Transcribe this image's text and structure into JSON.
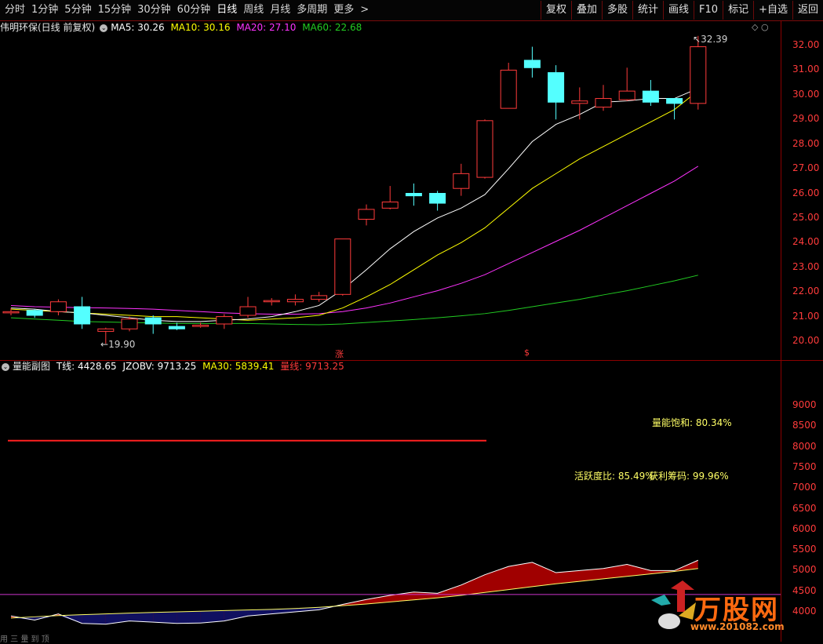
{
  "toolbar": {
    "periods": [
      "分时",
      "1分钟",
      "5分钟",
      "15分钟",
      "30分钟",
      "60分钟",
      "日线",
      "周线",
      "月线",
      "多周期",
      "更多"
    ],
    "more_arrow": ">",
    "buttons": [
      "复权",
      "叠加",
      "多股",
      "统计",
      "画线",
      "F10",
      "标记",
      "+自选",
      "返回"
    ]
  },
  "main_info": {
    "stock_name": "伟明环保(日线 前复权)",
    "ma5": "MA5: 30.26",
    "ma10": "MA10: 30.16",
    "ma20": "MA20: 27.10",
    "ma60": "MA60: 22.68"
  },
  "sub_info": {
    "title": "量能副图",
    "t_line": "T线: 4428.65",
    "jzobv": "JZOBV: 9713.25",
    "ma30": "MA30: 5839.41",
    "vol_line": "量线: 9713.25"
  },
  "price_axis": [
    "32.00",
    "31.00",
    "30.00",
    "29.00",
    "28.00",
    "27.00",
    "26.00",
    "25.00",
    "24.00",
    "23.00",
    "22.00",
    "21.00",
    "20.00"
  ],
  "sub_axis": [
    "9000",
    "8500",
    "8000",
    "7500",
    "7000",
    "6500",
    "6000",
    "5500",
    "5000",
    "4500",
    "4000"
  ],
  "annotations": {
    "high": "32.39",
    "low": "19.90",
    "mark_up": "涨",
    "mark_s": "$",
    "saturation": "量能饱和: 80.34%",
    "activity": "活跃度比: 85.49%",
    "profit": "获利筹码: 99.96%"
  },
  "watermark": {
    "brand": "万股网",
    "url": "www.201082.com"
  },
  "footer_text": "用 三 量 到 顶",
  "colors": {
    "up": "#ff3b3b",
    "down": "#54ffff",
    "ma5": "#ffffff",
    "ma10": "#ffff00",
    "ma20": "#ff33ff",
    "ma60": "#22cc22",
    "area": "#a00000",
    "axis": "#ff3b3b"
  },
  "candles": [
    {
      "o": 21.15,
      "c": 21.2,
      "h": 21.35,
      "l": 21.05
    },
    {
      "o": 21.25,
      "c": 21.05,
      "h": 21.3,
      "l": 20.95
    },
    {
      "o": 21.2,
      "c": 21.6,
      "h": 21.7,
      "l": 21.05
    },
    {
      "o": 21.4,
      "c": 20.7,
      "h": 21.8,
      "l": 20.5
    },
    {
      "o": 20.4,
      "c": 20.5,
      "h": 20.55,
      "l": 19.9
    },
    {
      "o": 20.5,
      "c": 20.9,
      "h": 21.0,
      "l": 20.4
    },
    {
      "o": 20.95,
      "c": 20.7,
      "h": 21.05,
      "l": 20.3
    },
    {
      "o": 20.6,
      "c": 20.5,
      "h": 20.75,
      "l": 20.45
    },
    {
      "o": 20.6,
      "c": 20.65,
      "h": 20.75,
      "l": 20.55
    },
    {
      "o": 20.7,
      "c": 21.0,
      "h": 21.1,
      "l": 20.5
    },
    {
      "o": 21.05,
      "c": 21.4,
      "h": 21.8,
      "l": 20.95
    },
    {
      "o": 21.6,
      "c": 21.65,
      "h": 21.75,
      "l": 21.45
    },
    {
      "o": 21.6,
      "c": 21.7,
      "h": 21.9,
      "l": 21.45
    },
    {
      "o": 21.7,
      "c": 21.85,
      "h": 22.0,
      "l": 21.6
    },
    {
      "o": 21.9,
      "c": 24.15,
      "h": 24.15,
      "l": 21.85
    },
    {
      "o": 24.95,
      "c": 25.35,
      "h": 25.55,
      "l": 24.7
    },
    {
      "o": 25.4,
      "c": 25.65,
      "h": 26.3,
      "l": 25.35
    },
    {
      "o": 26.0,
      "c": 25.9,
      "h": 26.4,
      "l": 25.5
    },
    {
      "o": 26.0,
      "c": 25.6,
      "h": 26.1,
      "l": 25.3
    },
    {
      "o": 26.2,
      "c": 26.8,
      "h": 27.2,
      "l": 25.9
    },
    {
      "o": 26.65,
      "c": 28.95,
      "h": 29.0,
      "l": 26.6
    },
    {
      "o": 29.45,
      "c": 31.0,
      "h": 31.3,
      "l": 29.45
    },
    {
      "o": 31.4,
      "c": 31.1,
      "h": 31.95,
      "l": 30.7
    },
    {
      "o": 30.9,
      "c": 29.7,
      "h": 31.2,
      "l": 29.0
    },
    {
      "o": 29.65,
      "c": 29.75,
      "h": 30.3,
      "l": 29.0
    },
    {
      "o": 29.5,
      "c": 29.85,
      "h": 30.4,
      "l": 29.35
    },
    {
      "o": 29.8,
      "c": 30.15,
      "h": 31.1,
      "l": 29.75
    },
    {
      "o": 30.15,
      "c": 29.7,
      "h": 30.6,
      "l": 29.55
    },
    {
      "o": 29.85,
      "c": 29.65,
      "h": 29.85,
      "l": 29.0
    },
    {
      "o": 29.65,
      "c": 31.95,
      "h": 32.39,
      "l": 29.4
    }
  ],
  "ma5_line": [
    21.35,
    21.3,
    21.2,
    21.15,
    21.05,
    20.95,
    20.85,
    20.8,
    20.8,
    20.85,
    20.9,
    21.0,
    21.2,
    21.45,
    22.1,
    22.9,
    23.75,
    24.45,
    25.0,
    25.4,
    25.95,
    27.0,
    28.1,
    28.8,
    29.2,
    29.7,
    29.75,
    29.85,
    29.85,
    30.26
  ],
  "ma10_line": [
    21.3,
    21.25,
    21.2,
    21.15,
    21.1,
    21.05,
    21.0,
    21.0,
    20.95,
    20.9,
    20.85,
    20.9,
    20.95,
    21.05,
    21.35,
    21.8,
    22.3,
    22.9,
    23.5,
    24.0,
    24.6,
    25.4,
    26.2,
    26.8,
    27.4,
    27.9,
    28.4,
    28.9,
    29.4,
    30.16
  ],
  "ma20_line": [
    21.45,
    21.4,
    21.38,
    21.36,
    21.35,
    21.33,
    21.3,
    21.25,
    21.2,
    21.15,
    21.12,
    21.1,
    21.1,
    21.12,
    21.2,
    21.35,
    21.55,
    21.8,
    22.05,
    22.35,
    22.7,
    23.15,
    23.6,
    24.05,
    24.5,
    25.0,
    25.5,
    26.0,
    26.5,
    27.1
  ],
  "ma60_line": [
    20.95,
    20.9,
    20.85,
    20.8,
    20.78,
    20.76,
    20.74,
    20.72,
    20.72,
    20.72,
    20.72,
    20.7,
    20.68,
    20.67,
    20.7,
    20.76,
    20.82,
    20.88,
    20.95,
    21.03,
    21.12,
    21.25,
    21.4,
    21.55,
    21.7,
    21.88,
    22.05,
    22.25,
    22.45,
    22.68
  ],
  "vol_line": [
    3900,
    3800,
    3950,
    3720,
    3700,
    3780,
    3750,
    3720,
    3730,
    3780,
    3900,
    3950,
    4000,
    4050,
    4180,
    4300,
    4400,
    4480,
    4450,
    4650,
    4900,
    5100,
    5200,
    4950,
    5000,
    5050,
    5150,
    5000,
    5000,
    5250
  ],
  "t_line": [
    3850,
    3880,
    3910,
    3930,
    3950,
    3970,
    3985,
    4000,
    4015,
    4030,
    4045,
    4060,
    4080,
    4110,
    4150,
    4190,
    4240,
    4290,
    4340,
    4400,
    4470,
    4540,
    4610,
    4680,
    4740,
    4800,
    4860,
    4920,
    4980,
    5050
  ],
  "ref_line_upper": 8150,
  "ref_line_lower": 4420
}
